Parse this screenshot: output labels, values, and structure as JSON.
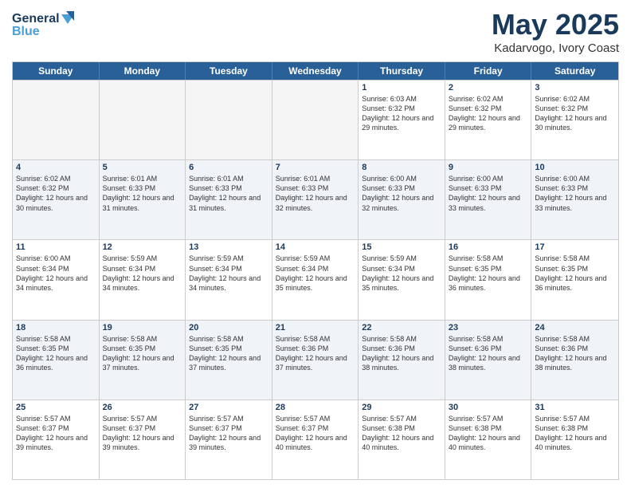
{
  "header": {
    "logo_line1": "General",
    "logo_line2": "Blue",
    "month": "May 2025",
    "location": "Kadarvogo, Ivory Coast"
  },
  "days_of_week": [
    "Sunday",
    "Monday",
    "Tuesday",
    "Wednesday",
    "Thursday",
    "Friday",
    "Saturday"
  ],
  "weeks": [
    [
      {
        "day": "",
        "info": "",
        "empty": true
      },
      {
        "day": "",
        "info": "",
        "empty": true
      },
      {
        "day": "",
        "info": "",
        "empty": true
      },
      {
        "day": "",
        "info": "",
        "empty": true
      },
      {
        "day": "1",
        "info": "Sunrise: 6:03 AM\nSunset: 6:32 PM\nDaylight: 12 hours\nand 29 minutes.",
        "empty": false
      },
      {
        "day": "2",
        "info": "Sunrise: 6:02 AM\nSunset: 6:32 PM\nDaylight: 12 hours\nand 29 minutes.",
        "empty": false
      },
      {
        "day": "3",
        "info": "Sunrise: 6:02 AM\nSunset: 6:32 PM\nDaylight: 12 hours\nand 30 minutes.",
        "empty": false
      }
    ],
    [
      {
        "day": "4",
        "info": "Sunrise: 6:02 AM\nSunset: 6:32 PM\nDaylight: 12 hours\nand 30 minutes.",
        "empty": false
      },
      {
        "day": "5",
        "info": "Sunrise: 6:01 AM\nSunset: 6:33 PM\nDaylight: 12 hours\nand 31 minutes.",
        "empty": false
      },
      {
        "day": "6",
        "info": "Sunrise: 6:01 AM\nSunset: 6:33 PM\nDaylight: 12 hours\nand 31 minutes.",
        "empty": false
      },
      {
        "day": "7",
        "info": "Sunrise: 6:01 AM\nSunset: 6:33 PM\nDaylight: 12 hours\nand 32 minutes.",
        "empty": false
      },
      {
        "day": "8",
        "info": "Sunrise: 6:00 AM\nSunset: 6:33 PM\nDaylight: 12 hours\nand 32 minutes.",
        "empty": false
      },
      {
        "day": "9",
        "info": "Sunrise: 6:00 AM\nSunset: 6:33 PM\nDaylight: 12 hours\nand 33 minutes.",
        "empty": false
      },
      {
        "day": "10",
        "info": "Sunrise: 6:00 AM\nSunset: 6:33 PM\nDaylight: 12 hours\nand 33 minutes.",
        "empty": false
      }
    ],
    [
      {
        "day": "11",
        "info": "Sunrise: 6:00 AM\nSunset: 6:34 PM\nDaylight: 12 hours\nand 34 minutes.",
        "empty": false
      },
      {
        "day": "12",
        "info": "Sunrise: 5:59 AM\nSunset: 6:34 PM\nDaylight: 12 hours\nand 34 minutes.",
        "empty": false
      },
      {
        "day": "13",
        "info": "Sunrise: 5:59 AM\nSunset: 6:34 PM\nDaylight: 12 hours\nand 34 minutes.",
        "empty": false
      },
      {
        "day": "14",
        "info": "Sunrise: 5:59 AM\nSunset: 6:34 PM\nDaylight: 12 hours\nand 35 minutes.",
        "empty": false
      },
      {
        "day": "15",
        "info": "Sunrise: 5:59 AM\nSunset: 6:34 PM\nDaylight: 12 hours\nand 35 minutes.",
        "empty": false
      },
      {
        "day": "16",
        "info": "Sunrise: 5:58 AM\nSunset: 6:35 PM\nDaylight: 12 hours\nand 36 minutes.",
        "empty": false
      },
      {
        "day": "17",
        "info": "Sunrise: 5:58 AM\nSunset: 6:35 PM\nDaylight: 12 hours\nand 36 minutes.",
        "empty": false
      }
    ],
    [
      {
        "day": "18",
        "info": "Sunrise: 5:58 AM\nSunset: 6:35 PM\nDaylight: 12 hours\nand 36 minutes.",
        "empty": false
      },
      {
        "day": "19",
        "info": "Sunrise: 5:58 AM\nSunset: 6:35 PM\nDaylight: 12 hours\nand 37 minutes.",
        "empty": false
      },
      {
        "day": "20",
        "info": "Sunrise: 5:58 AM\nSunset: 6:35 PM\nDaylight: 12 hours\nand 37 minutes.",
        "empty": false
      },
      {
        "day": "21",
        "info": "Sunrise: 5:58 AM\nSunset: 6:36 PM\nDaylight: 12 hours\nand 37 minutes.",
        "empty": false
      },
      {
        "day": "22",
        "info": "Sunrise: 5:58 AM\nSunset: 6:36 PM\nDaylight: 12 hours\nand 38 minutes.",
        "empty": false
      },
      {
        "day": "23",
        "info": "Sunrise: 5:58 AM\nSunset: 6:36 PM\nDaylight: 12 hours\nand 38 minutes.",
        "empty": false
      },
      {
        "day": "24",
        "info": "Sunrise: 5:58 AM\nSunset: 6:36 PM\nDaylight: 12 hours\nand 38 minutes.",
        "empty": false
      }
    ],
    [
      {
        "day": "25",
        "info": "Sunrise: 5:57 AM\nSunset: 6:37 PM\nDaylight: 12 hours\nand 39 minutes.",
        "empty": false
      },
      {
        "day": "26",
        "info": "Sunrise: 5:57 AM\nSunset: 6:37 PM\nDaylight: 12 hours\nand 39 minutes.",
        "empty": false
      },
      {
        "day": "27",
        "info": "Sunrise: 5:57 AM\nSunset: 6:37 PM\nDaylight: 12 hours\nand 39 minutes.",
        "empty": false
      },
      {
        "day": "28",
        "info": "Sunrise: 5:57 AM\nSunset: 6:37 PM\nDaylight: 12 hours\nand 40 minutes.",
        "empty": false
      },
      {
        "day": "29",
        "info": "Sunrise: 5:57 AM\nSunset: 6:38 PM\nDaylight: 12 hours\nand 40 minutes.",
        "empty": false
      },
      {
        "day": "30",
        "info": "Sunrise: 5:57 AM\nSunset: 6:38 PM\nDaylight: 12 hours\nand 40 minutes.",
        "empty": false
      },
      {
        "day": "31",
        "info": "Sunrise: 5:57 AM\nSunset: 6:38 PM\nDaylight: 12 hours\nand 40 minutes.",
        "empty": false
      }
    ]
  ]
}
